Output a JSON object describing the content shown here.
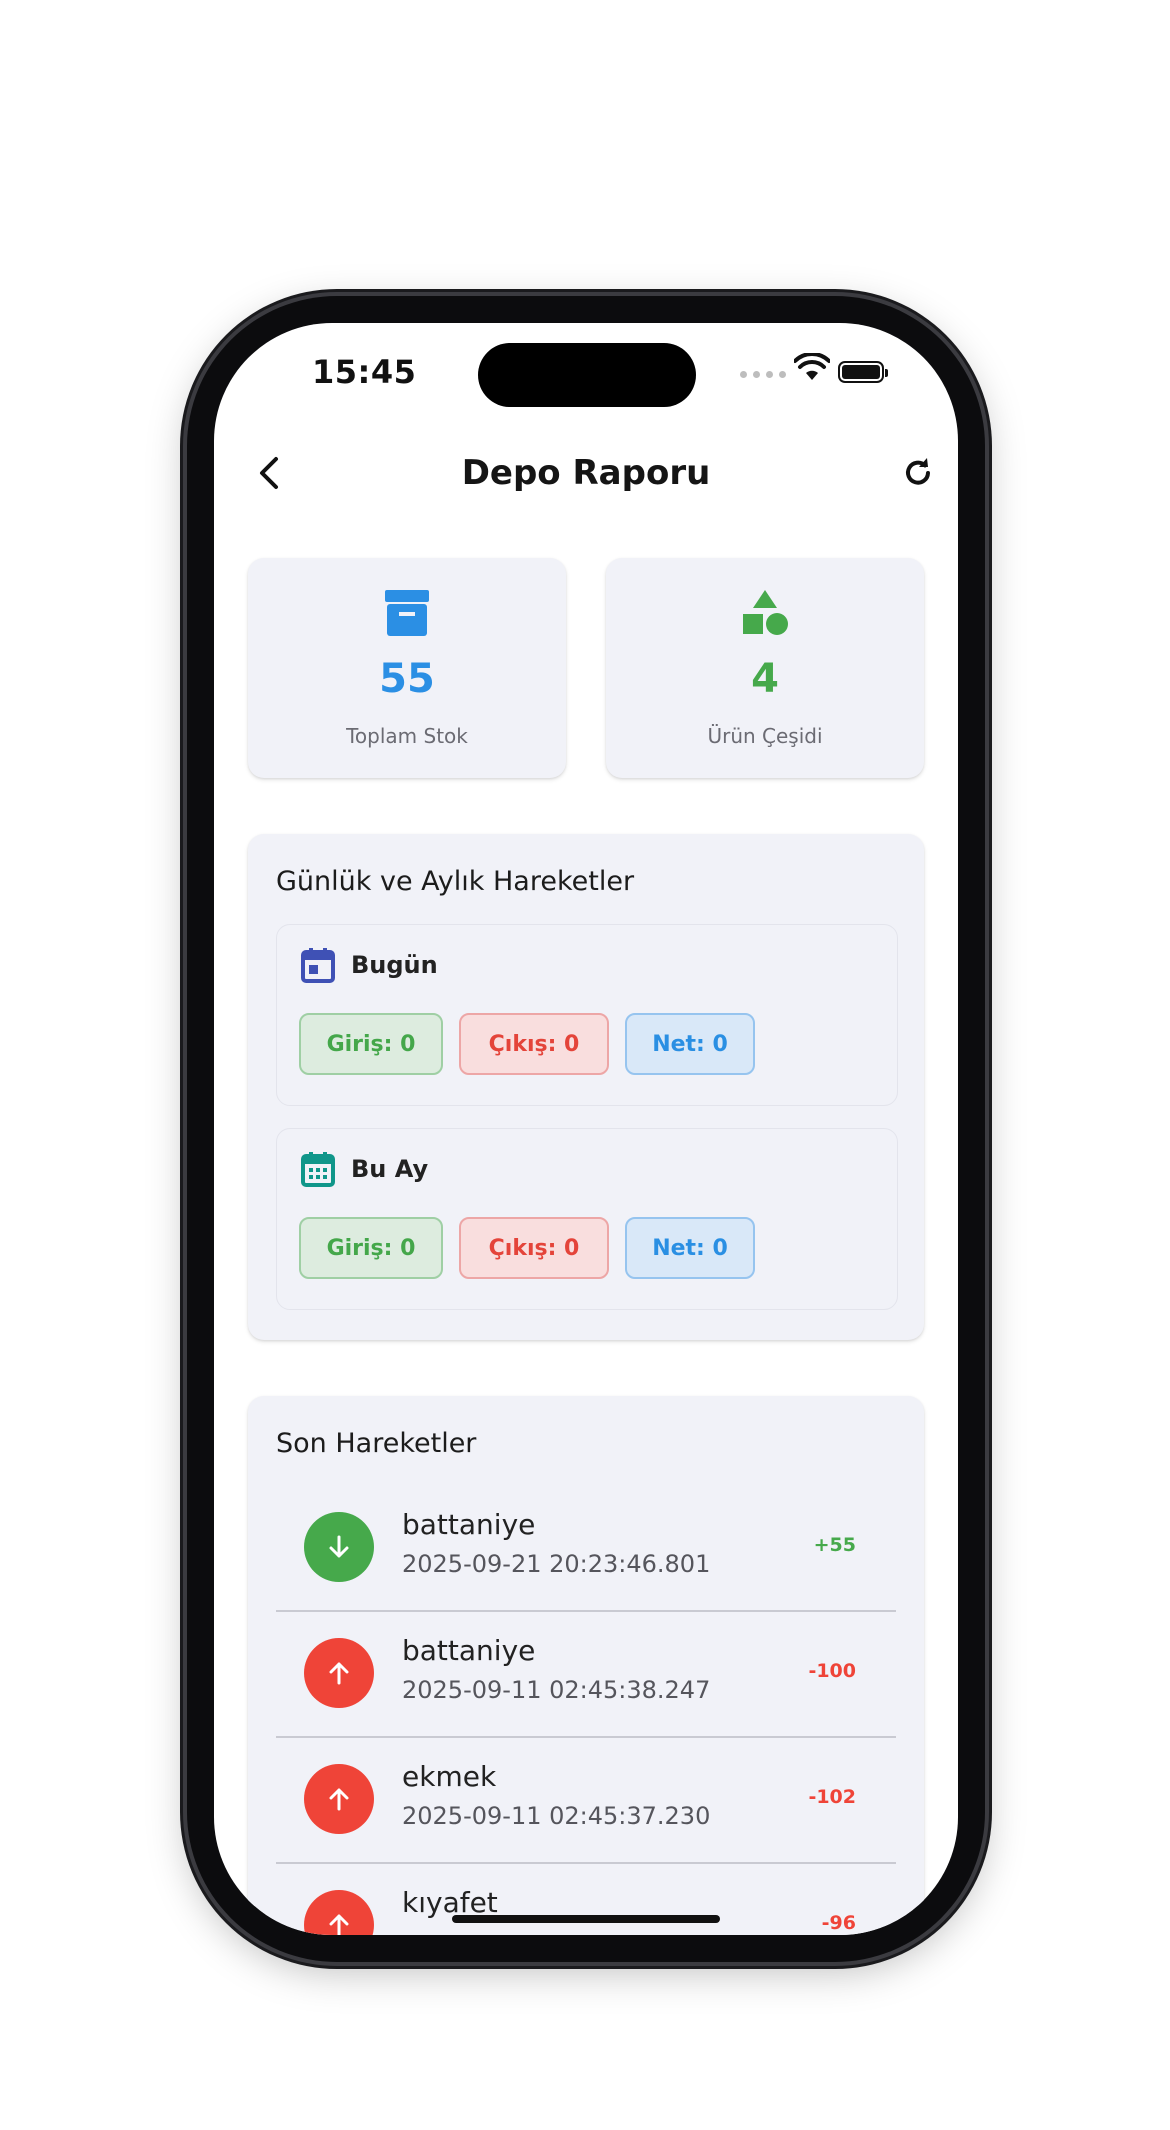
{
  "status_bar": {
    "time": "15:45"
  },
  "app_bar": {
    "title": "Depo Raporu",
    "back_icon": "chevron-left-icon",
    "refresh_icon": "refresh-icon"
  },
  "summary": [
    {
      "icon": "archive-box-icon",
      "value": "55",
      "label": "Toplam Stok",
      "color": "#2b8fe4"
    },
    {
      "icon": "shapes-icon",
      "value": "4",
      "label": "Ürün Çeşidi",
      "color": "#46a94b"
    }
  ],
  "periods": {
    "title": "Günlük ve Aylık Hareketler",
    "items": [
      {
        "name": "Bugün",
        "icon": "calendar-today-icon",
        "icon_color": "#3f51b5",
        "in": "Giriş: 0",
        "out": "Çıkış: 0",
        "net": "Net: 0"
      },
      {
        "name": "Bu Ay",
        "icon": "calendar-month-icon",
        "icon_color": "#10968a",
        "in": "Giriş: 0",
        "out": "Çıkış: 0",
        "net": "Net: 0"
      }
    ]
  },
  "recent": {
    "title": "Son Hareketler",
    "items": [
      {
        "name": "battaniye",
        "date": "2025-09-21 20:23:46.801",
        "qty": "+55",
        "direction": "in",
        "color": "#46a94b"
      },
      {
        "name": "battaniye",
        "date": "2025-09-11 02:45:38.247",
        "qty": "-100",
        "direction": "out",
        "color": "#ef4438"
      },
      {
        "name": "ekmek",
        "date": "2025-09-11 02:45:37.230",
        "qty": "-102",
        "direction": "out",
        "color": "#ef4438"
      },
      {
        "name": "kıyafet",
        "date": "",
        "qty": "-96",
        "direction": "out",
        "color": "#ef4438"
      }
    ]
  }
}
